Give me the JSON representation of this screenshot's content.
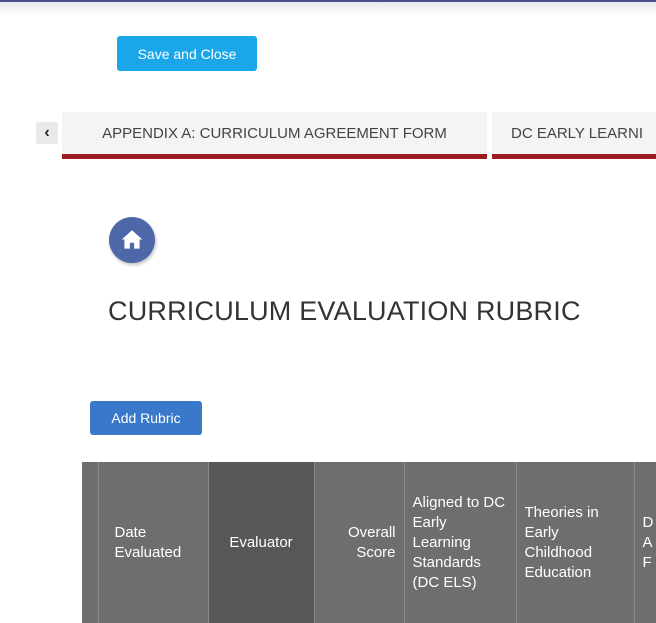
{
  "toolbar": {
    "save_close_label": "Save and Close"
  },
  "tabs": [
    {
      "label": "APPENDIX A: CURRICULUM AGREEMENT FORM"
    },
    {
      "label": "DC EARLY LEARNI"
    }
  ],
  "page": {
    "title": "CURRICULUM EVALUATION RUBRIC"
  },
  "actions": {
    "add_rubric_label": "Add Rubric"
  },
  "table": {
    "columns": [
      {
        "label": ""
      },
      {
        "label": "Date Evaluated"
      },
      {
        "label": "Evaluator"
      },
      {
        "label": "Overall Score"
      },
      {
        "label": "Aligned to DC Early Learning Standards (DC ELS)"
      },
      {
        "label": "Theories in Early Childhood Education"
      },
      {
        "label": "D A F ("
      }
    ]
  },
  "colors": {
    "save_button": "#1aa6e9",
    "add_button": "#3a78c9",
    "tab_underline": "#9b1c20",
    "home_icon_bg": "#4e67a9",
    "table_header": "#6e6e6e"
  },
  "icons": {
    "tabs_prev": "chevron-left-icon",
    "home": "home-icon"
  }
}
